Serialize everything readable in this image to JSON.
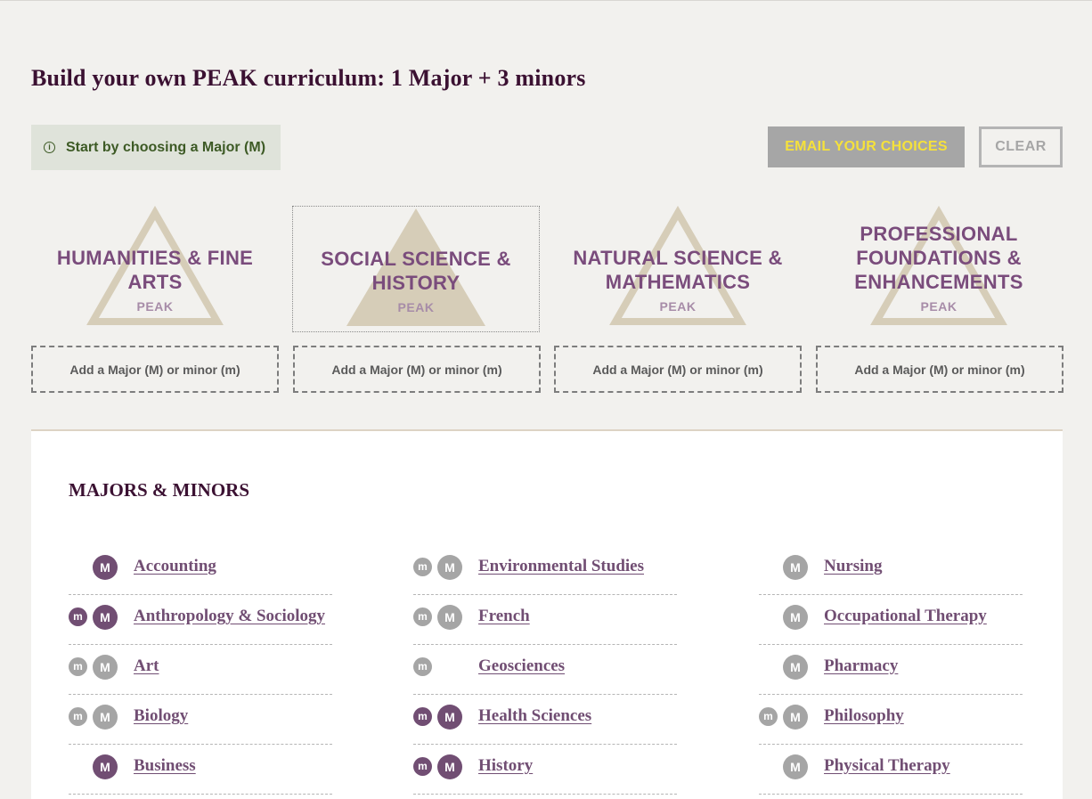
{
  "title": "Build your own PEAK curriculum: 1 Major + 3 minors",
  "info": {
    "icon": "info-icon",
    "text": "Start by choosing a Major (M)"
  },
  "buttons": {
    "email": "EMAIL YOUR CHOICES",
    "clear": "CLEAR"
  },
  "colors": {
    "accent": "#714e73",
    "heading": "#3b1132",
    "disabled": "#a5a5a5",
    "email_text": "#f5e13b"
  },
  "categories": [
    {
      "name": "HUMANITIES & FINE ARTS",
      "sub": "PEAK",
      "add": "Add a Major (M) or minor (m)",
      "selected": false
    },
    {
      "name": "SOCIAL SCIENCE & HISTORY",
      "sub": "PEAK",
      "add": "Add a Major (M) or minor (m)",
      "selected": true
    },
    {
      "name": "NATURAL SCIENCE & MATHEMATICS",
      "sub": "PEAK",
      "add": "Add a Major (M) or minor (m)",
      "selected": false
    },
    {
      "name": "PROFESSIONAL FOUNDATIONS & ENHANCEMENTS",
      "sub": "PEAK",
      "add": "Add a Major (M) or minor (m)",
      "selected": false
    }
  ],
  "panel": {
    "title": "MAJORS & MINORS",
    "badge_minor": "m",
    "badge_major": "M",
    "columns": [
      [
        {
          "name": "Accounting",
          "minor": null,
          "major": "on"
        },
        {
          "name": "Anthropology & Sociology",
          "minor": "on",
          "major": "on"
        },
        {
          "name": "Art",
          "minor": "off",
          "major": "off"
        },
        {
          "name": "Biology",
          "minor": "off",
          "major": "off"
        },
        {
          "name": "Business",
          "minor": null,
          "major": "on"
        }
      ],
      [
        {
          "name": "Environmental Studies",
          "minor": "off",
          "major": "off"
        },
        {
          "name": "French",
          "minor": "off",
          "major": "off"
        },
        {
          "name": "Geosciences",
          "minor": "off",
          "major": null
        },
        {
          "name": "Health Sciences",
          "minor": "on",
          "major": "on"
        },
        {
          "name": "History",
          "minor": "on",
          "major": "on"
        }
      ],
      [
        {
          "name": "Nursing",
          "minor": null,
          "major": "off"
        },
        {
          "name": "Occupational Therapy",
          "minor": null,
          "major": "off"
        },
        {
          "name": "Pharmacy",
          "minor": null,
          "major": "off"
        },
        {
          "name": "Philosophy",
          "minor": "off",
          "major": "off"
        },
        {
          "name": "Physical Therapy",
          "minor": null,
          "major": "off"
        }
      ]
    ]
  }
}
